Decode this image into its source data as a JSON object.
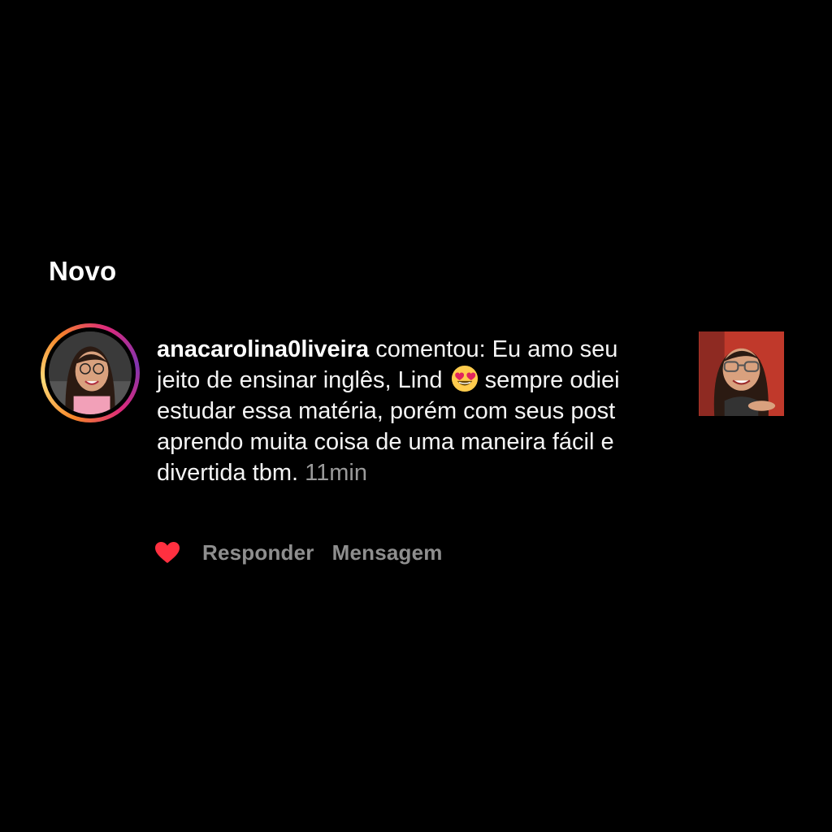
{
  "section": {
    "title": "Novo"
  },
  "notification": {
    "username": "anacarolina0liveira",
    "text_part1": " comentou: Eu amo seu jeito de ensinar inglês,  Lind ",
    "emoji": "heart-eyes-emoji",
    "text_part2": " sempre odiei estudar essa matéria, porém com seus post aprendo muita coisa de uma maneira fácil e divertida tbm. ",
    "time": "11min",
    "liked": true
  },
  "actions": {
    "reply_label": "Responder",
    "message_label": "Mensagem"
  },
  "colors": {
    "background": "#000000",
    "heart": "#ff3040",
    "secondary_text": "#8e8e8e"
  },
  "icons": {
    "like": "heart-icon"
  }
}
